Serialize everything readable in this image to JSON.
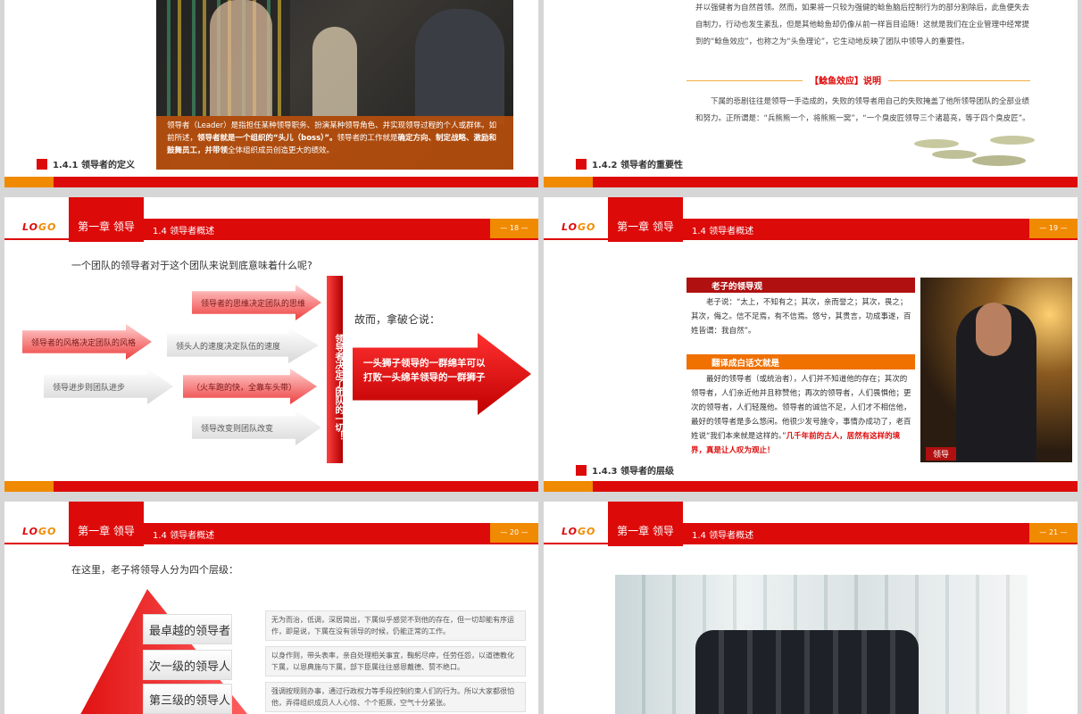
{
  "slide1": {
    "caption_text": "领导者（Leader）是指担任某种领导职务、扮演某种领导角色、并实现领导过程的个人或群体。如前所述，",
    "caption_bold1": "领导者就是一个组织的“头儿（boss）”。",
    "caption_text2": "领导者的工作就是",
    "caption_bold2": "确定方向、制定战略、激励和鼓舞员工，并带领",
    "caption_text3": "全体组织成员创造更大的绩效。",
    "subhead": "1.4.1 领导者的定义"
  },
  "slide2": {
    "paragraph1": "并以强健者为自然首领。然而，如果将一只较为强健的鲶鱼脑后控制行为的部分割除后，此鱼便失去自制力，行动也发生紊乱，但是其他鲶鱼却仍像从前一样盲目追随！这就是我们在企业管理中经常提到的“鲶鱼效应”，也称之为“头鱼理论”，它生动地反映了团队中领导人的重要性。",
    "effect_title": "【鲶鱼效应】说明",
    "paragraph2": "下属的悲剧往往是领导一手造成的，失败的领导者用自己的失败掩盖了他所领导团队的全部业绩和努力。正所谓是：“兵熊熊一个，将熊熊一窝”，“一个臭皮匠领导三个诸葛亮，等于四个臭皮匠”。",
    "subhead": "1.4.2 领导者的重要性"
  },
  "header": {
    "logo_a": "LO",
    "logo_b": "GO",
    "chapter": "第一章 领导",
    "section": "1.4 领导者概述"
  },
  "slide3": {
    "page": "— 18 —",
    "question": "一个团队的领导者对于这个团队来说到底意味着什么呢?",
    "arrows": [
      "领导者的思维决定团队的思维",
      "领导者的风格决定团队的风格",
      "领头人的速度决定队伍的速度",
      "领导进步则团队进步",
      "（火车跑的快，全靠车头带）",
      "领导改变则团队改变"
    ],
    "vertical_bar": "领导者决定了团队的一切！",
    "therefore": "故而，拿破仑说：",
    "big_arrow_line1": "一头狮子领导的一群绵羊可以",
    "big_arrow_line2": "打败一头绵羊领导的一群狮子"
  },
  "slide4": {
    "page": "— 19 —",
    "box1_title": "老子的领导观",
    "box1_text": "老子说：“太上，不知有之；其次，亲而誉之；其次，畏之；其次，侮之。信不足焉，有不信焉。悠兮，其贵言，功成事遂，百姓皆谓：我自然”。",
    "box2_title": "翻译成白话文就是",
    "box2_text": "最好的领导者（或统治者），人们并不知道他的存在；其次的领导者，人们亲近他并且称赞他；再次的领导者，人们畏惧他；更次的领导者，人们轻蔑他。领导者的诚信不足，人们才不相信他，最好的领导者是多么悠闲。他很少发号施令，事情办成功了，老百姓说“我们本来就是这样的。”",
    "box2_highlight": "几千年前的古人，居然有这样的境界，真是让人叹为观止！",
    "photo_label": "领导",
    "subhead": "1.4.3 领导者的层级"
  },
  "slide5": {
    "page": "— 20 —",
    "intro": "在这里，老子将领导人分为四个层级：",
    "levels": [
      {
        "name": "最卓越的领导者",
        "desc": "无为而治，低调，深居简出，下属似乎感觉不到他的存在，但一切却能有序运作，即是说，下属在没有领导的时候，仍能正常的工作。"
      },
      {
        "name": "次一级的领导人",
        "desc": "以身作则，带头表率，亲自处理相关事宜，鞠躬尽瘁，任劳任怨，以道德教化下属，以恩典施与下属，部下臣属往往感恩戴德、赞不绝口。"
      },
      {
        "name": "第三级的领导人",
        "desc": "强调按规则办事，通过行政权力等手段控制约束人们的行为。所以大家都很怕他，弄得组织成员人人心惊、个个拒厥，空气十分紧张。"
      }
    ]
  },
  "slide6": {
    "page": "— 21 —"
  },
  "colors": {
    "red": "#dd0a0a",
    "orange": "#f08a00",
    "dark_red": "#b01010"
  }
}
